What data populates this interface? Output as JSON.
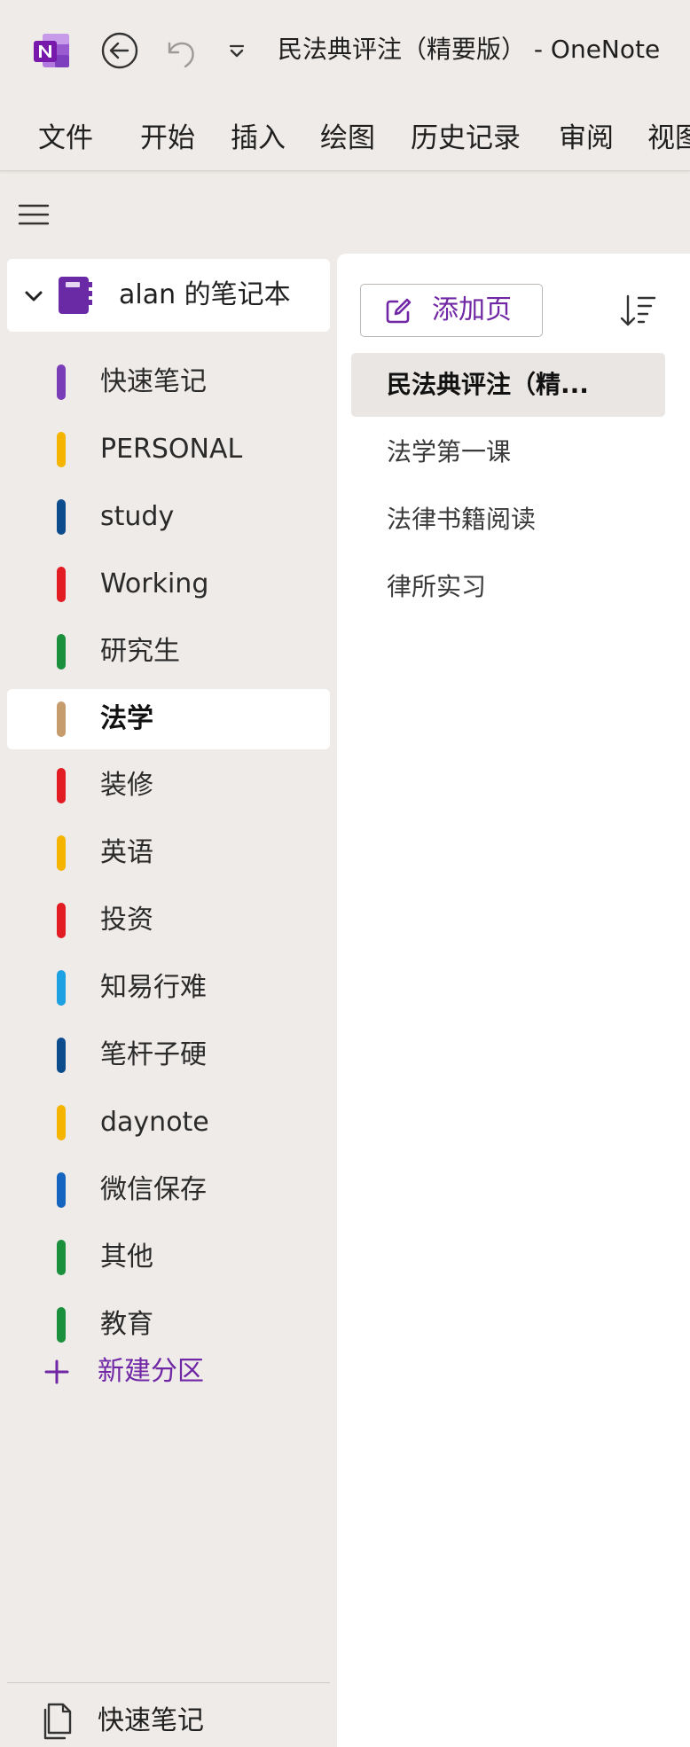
{
  "titlebar": {
    "title": "民法典评注（精要版）  -  OneNote"
  },
  "menu": {
    "items": [
      "文件",
      "开始",
      "插入",
      "绘图",
      "历史记录",
      "审阅",
      "视图"
    ]
  },
  "sidebar": {
    "notebook": "alan 的笔记本",
    "sections": [
      {
        "label": "快速笔记",
        "color": "#7a3db8"
      },
      {
        "label": "PERSONAL",
        "color": "#f4b400"
      },
      {
        "label": "study",
        "color": "#0d4c8c"
      },
      {
        "label": "Working",
        "color": "#e31b23"
      },
      {
        "label": "研究生",
        "color": "#1a8f3c"
      },
      {
        "label": "法学",
        "color": "#c69c6d"
      },
      {
        "label": "装修",
        "color": "#e31b23"
      },
      {
        "label": "英语",
        "color": "#f4b400"
      },
      {
        "label": "投资",
        "color": "#e31b23"
      },
      {
        "label": "知易行难",
        "color": "#1da1e2"
      },
      {
        "label": "笔杆子硬",
        "color": "#0d4c8c"
      },
      {
        "label": "daynote",
        "color": "#f4b400"
      },
      {
        "label": "微信保存",
        "color": "#1565c0"
      },
      {
        "label": "其他",
        "color": "#1a8f3c"
      },
      {
        "label": "教育",
        "color": "#1a8f3c"
      }
    ],
    "selected_section": "法学",
    "new_section_label": "新建分区",
    "quick_notes_label": "快速笔记"
  },
  "pages": {
    "add_page_label": "添加页",
    "items": [
      "民法典评注（精...",
      "法学第一课",
      "法律书籍阅读",
      "律所实习"
    ],
    "selected_page": "民法典评注（精..."
  },
  "colors": {
    "accent": "#7027a5",
    "background": "#efebe8",
    "panel": "#ffffff",
    "selected_page_bg": "#e9e6e3"
  }
}
